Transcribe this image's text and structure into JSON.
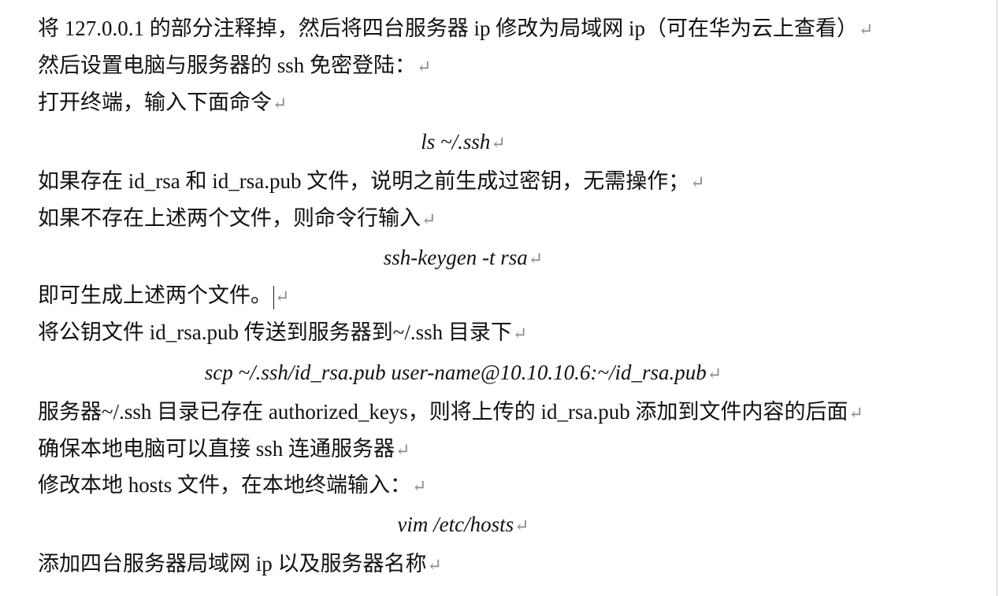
{
  "paragraph_mark": "↵",
  "lines": [
    "将 127.0.0.1 的部分注释掉，然后将四台服务器 ip 修改为局域网 ip（可在华为云上查看）",
    "然后设置电脑与服务器的 ssh 免密登陆：",
    "打开终端，输入下面命令",
    "ls ~/.ssh",
    "如果存在 id_rsa 和 id_rsa.pub 文件，说明之前生成过密钥，无需操作；",
    "如果不存在上述两个文件，则命令行输入",
    "ssh-keygen -t rsa",
    "即可生成上述两个文件。",
    "将公钥文件 id_rsa.pub 传送到服务器到~/.ssh 目录下",
    "scp ~/.ssh/id_rsa.pub user-name@10.10.10.6:~/id_rsa.pub",
    "服务器~/.ssh 目录已存在 authorized_keys，则将上传的 id_rsa.pub 添加到文件内容的后面",
    "确保本地电脑可以直接 ssh 连通服务器",
    "修改本地 hosts 文件，在本地终端输入：",
    "vim /etc/hosts",
    "添加四台服务器局域网 ip 以及服务器名称"
  ]
}
